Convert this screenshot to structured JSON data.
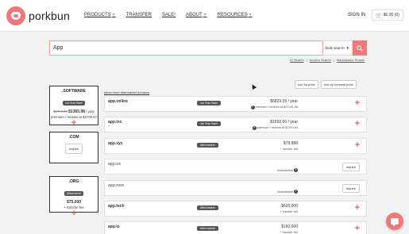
{
  "brand": {
    "name": "porkbun"
  },
  "nav": [
    {
      "label": "PRODUCTS",
      "caret": true
    },
    {
      "label": "TRANSFER",
      "caret": false
    },
    {
      "label": "SALE!",
      "caret": false
    },
    {
      "label": "ABOUT",
      "caret": true
    },
    {
      "label": "RESOURCES",
      "caret": true
    }
  ],
  "header": {
    "sign_in": "SIGN IN",
    "cart": "$0.00 (0)"
  },
  "search": {
    "value": "App",
    "bulk_label": "Bulk search",
    "links": [
      "AI Search",
      "Auction Search",
      "Marketplace Search"
    ]
  },
  "sort": {
    "by_price": "sort by price",
    "by_renewal": "sort by renewal price"
  },
  "show_more": "show more aftermarket domains",
  "cards": [
    {
      "tld": ".SOFTWARE",
      "badge": "1st Year Sale!",
      "old_price": "$2759.60",
      "price": "$1365.98",
      "per": "/ year",
      "renew": "premium / renews at $2759.67",
      "action": "+"
    },
    {
      "tld": ".COM",
      "action_label": "Inquire"
    },
    {
      "tld": ".ORG",
      "badge": "Aftermarket",
      "price": "$75,000",
      "sub": "+ transfer fee",
      "action": "+"
    }
  ],
  "results": [
    {
      "name": "app.online",
      "badge": "1st Year Sale!",
      "price": "$6823.39 / year",
      "sub": "premium / renews at $27291.98",
      "action": "+"
    },
    {
      "name": "app.inc",
      "badge": "1st Year Sale!",
      "price": "$1692.60 / year",
      "sub": "premium / renews at $2193.84",
      "action": "+"
    },
    {
      "name": "app.xyz",
      "badge": "Aftermarket",
      "price": "$79,888",
      "sub": "+ transfer fee",
      "action": "+"
    },
    {
      "name": "app.us",
      "status": "unavailable",
      "action_label": "Inquire"
    },
    {
      "name": "app.new",
      "status": "unavailable",
      "action_label": "Inquire"
    },
    {
      "name": "app.tech",
      "badge": "Aftermarket",
      "price": "$625,000",
      "sub": "+ transfer fee",
      "action": "+"
    },
    {
      "name": "app.io",
      "badge": "Aftermarket",
      "price": "$160,000",
      "sub": "+ transfer fee",
      "action": "+"
    }
  ],
  "colors": {
    "accent": "#ef7878",
    "badge": "#555555"
  }
}
